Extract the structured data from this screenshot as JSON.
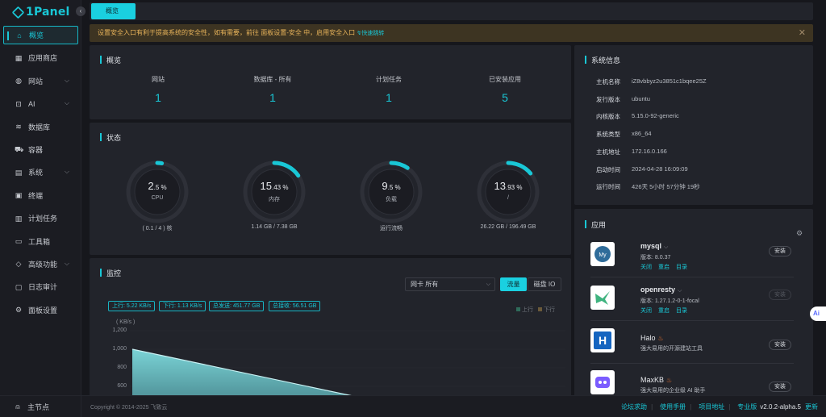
{
  "app": {
    "logo_text": "1Panel",
    "collapse_glyph": "‹"
  },
  "sidebar": {
    "items": [
      {
        "label": "概览",
        "icon": "home-icon",
        "glyph": "⌂",
        "chevron": false
      },
      {
        "label": "应用商店",
        "icon": "grid-icon",
        "glyph": "▦",
        "chevron": false
      },
      {
        "label": "网站",
        "icon": "globe-icon",
        "glyph": "◍",
        "chevron": true
      },
      {
        "label": "AI",
        "icon": "robot-icon",
        "glyph": "⊡",
        "chevron": true
      },
      {
        "label": "数据库",
        "icon": "database-icon",
        "glyph": "≋",
        "chevron": false
      },
      {
        "label": "容器",
        "icon": "container-icon",
        "glyph": "⛟",
        "chevron": false
      },
      {
        "label": "系统",
        "icon": "system-icon",
        "glyph": "▤",
        "chevron": true
      },
      {
        "label": "终端",
        "icon": "terminal-icon",
        "glyph": "▣",
        "chevron": false
      },
      {
        "label": "计划任务",
        "icon": "calendar-icon",
        "glyph": "▥",
        "chevron": false
      },
      {
        "label": "工具箱",
        "icon": "toolbox-icon",
        "glyph": "▭",
        "chevron": false
      },
      {
        "label": "高级功能",
        "icon": "diamond-icon",
        "glyph": "◇",
        "chevron": true
      },
      {
        "label": "日志审计",
        "icon": "log-icon",
        "glyph": "▢",
        "chevron": false
      },
      {
        "label": "面板设置",
        "icon": "settings-icon",
        "glyph": "⚙",
        "chevron": false
      }
    ],
    "bottom_label": "主节点"
  },
  "tabs": {
    "active": "概览"
  },
  "notice": {
    "text": "设置安全入口有利于提高系统的安全性，如有需要，前往 面板设置-安全 中，启用安全入口",
    "link": "快速跳转",
    "close": "✕"
  },
  "overview": {
    "title": "概览",
    "items": [
      {
        "label": "网站",
        "value": "1"
      },
      {
        "label": "数据库 - 所有",
        "value": "1"
      },
      {
        "label": "计划任务",
        "value": "1"
      },
      {
        "label": "已安装应用",
        "value": "5"
      }
    ]
  },
  "status": {
    "title": "状态",
    "gauges": [
      {
        "int": "2",
        "dec": ".5 %",
        "label": "CPU",
        "footer": "( 0.1 / 4 ) 核",
        "percent": 2.5
      },
      {
        "int": "15",
        "dec": ".43 %",
        "label": "内存",
        "footer": "1.14 GB / 7.38 GB",
        "percent": 15.43
      },
      {
        "int": "9",
        "dec": ".5 %",
        "label": "负载",
        "footer": "运行流畅",
        "percent": 9.5
      },
      {
        "int": "13",
        "dec": ".93 %",
        "label": "/",
        "footer": "26.22 GB / 196.49 GB",
        "percent": 13.93
      }
    ]
  },
  "monitor": {
    "title": "监控",
    "nic_select": "网卡  所有",
    "traffic_btn": "流量",
    "disk_btn": "磁盘 IO",
    "tags": [
      "上行: 5.22 KB/s",
      "下行: 1.13 KB/s",
      "总发送: 451.77 GB",
      "总接收: 56.51 GB"
    ],
    "legend": [
      {
        "name": "上行",
        "color": "#2f6b5a"
      },
      {
        "name": "下行",
        "color": "#6b5a3a"
      }
    ],
    "y_unit": "( KB/s )"
  },
  "chart_data": {
    "type": "area",
    "ylabel": "( KB/s )",
    "yticks": [
      "1,200",
      "1,000",
      "800",
      "600"
    ],
    "ylim": [
      600,
      1200
    ],
    "series": [
      {
        "name": "上行",
        "x": [
          0,
          1
        ],
        "values": [
          1000,
          600
        ]
      }
    ],
    "legend": [
      "上行",
      "下行"
    ],
    "colors": {
      "area_top": "#7ad3d6",
      "area_bottom": "#4e8f96"
    }
  },
  "sysinfo": {
    "title": "系统信息",
    "rows": [
      {
        "key": "主机名称",
        "val": "iZ8vbbyz2u3851c1bqee25Z"
      },
      {
        "key": "发行版本",
        "val": "ubuntu"
      },
      {
        "key": "内核版本",
        "val": "5.15.0-92-generic"
      },
      {
        "key": "系统类型",
        "val": "x86_64"
      },
      {
        "key": "主机地址",
        "val": "172.16.0.166"
      },
      {
        "key": "启动时间",
        "val": "2024-04-28 16:09:09"
      },
      {
        "key": "运行时间",
        "val": "426天 5小时 57分钟 19秒"
      }
    ]
  },
  "apps": {
    "title": "应用",
    "items": [
      {
        "name": "mysql",
        "sub": "版本: 8.0.37",
        "links": [
          "关闭",
          "重启",
          "目录"
        ],
        "btn": "安装",
        "icon": "mysql-icon",
        "chevron": true
      },
      {
        "name": "openresty",
        "sub": "版本: 1.27.1.2-0-1-focal",
        "links": [
          "关闭",
          "重启",
          "目录"
        ],
        "btn": "安装",
        "icon": "openresty-icon",
        "chevron": true
      },
      {
        "name": "Halo",
        "sub": "强大易用的开源建站工具",
        "links": [],
        "btn": "安装",
        "icon": "halo-icon",
        "chevron": false,
        "hot": true
      },
      {
        "name": "MaxKB",
        "sub": "强大易用的企业级 AI 助手",
        "links": [],
        "btn": "安装",
        "icon": "maxkb-icon",
        "chevron": false,
        "hot": true
      }
    ]
  },
  "footer": {
    "copyright": "Copyright © 2014-2025 飞致云",
    "links": [
      "论坛求助",
      "使用手册",
      "项目地址"
    ],
    "edition": "专业版",
    "version": "v2.0.2-alpha.5",
    "update": "更新"
  },
  "ai_fab": "Ai",
  "colors": {
    "accent": "#19c7d6",
    "warning_bg": "#3d3422",
    "warning_text": "#e8b35a",
    "card_bg": "#22242b",
    "page_bg": "#16171c"
  }
}
